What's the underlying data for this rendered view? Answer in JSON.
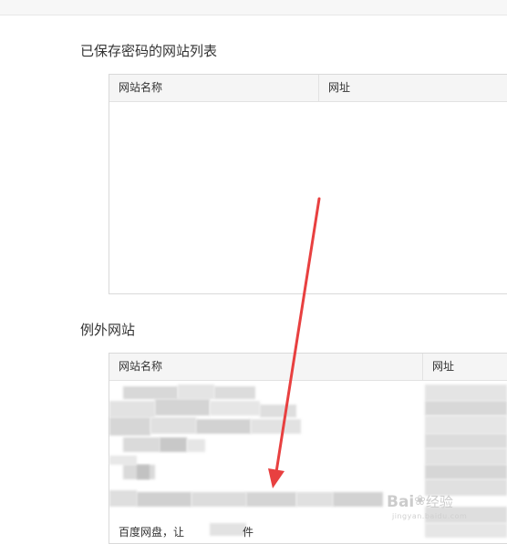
{
  "saved_section": {
    "title": "已保存密码的网站列表",
    "columns": [
      "网站名称",
      "网址"
    ]
  },
  "exception_section": {
    "title": "例外网站",
    "columns": [
      "网站名称",
      "网址"
    ],
    "visible_row_text": "百度网盘，让",
    "visible_row_trailing": "件"
  },
  "watermark": {
    "brand": "Bai",
    "product": "经验",
    "url": "jingyan.baidu.com"
  },
  "colors": {
    "annotation_arrow": "#e84040",
    "header_bg": "#f5f5f5",
    "border": "#d9d9d9"
  }
}
